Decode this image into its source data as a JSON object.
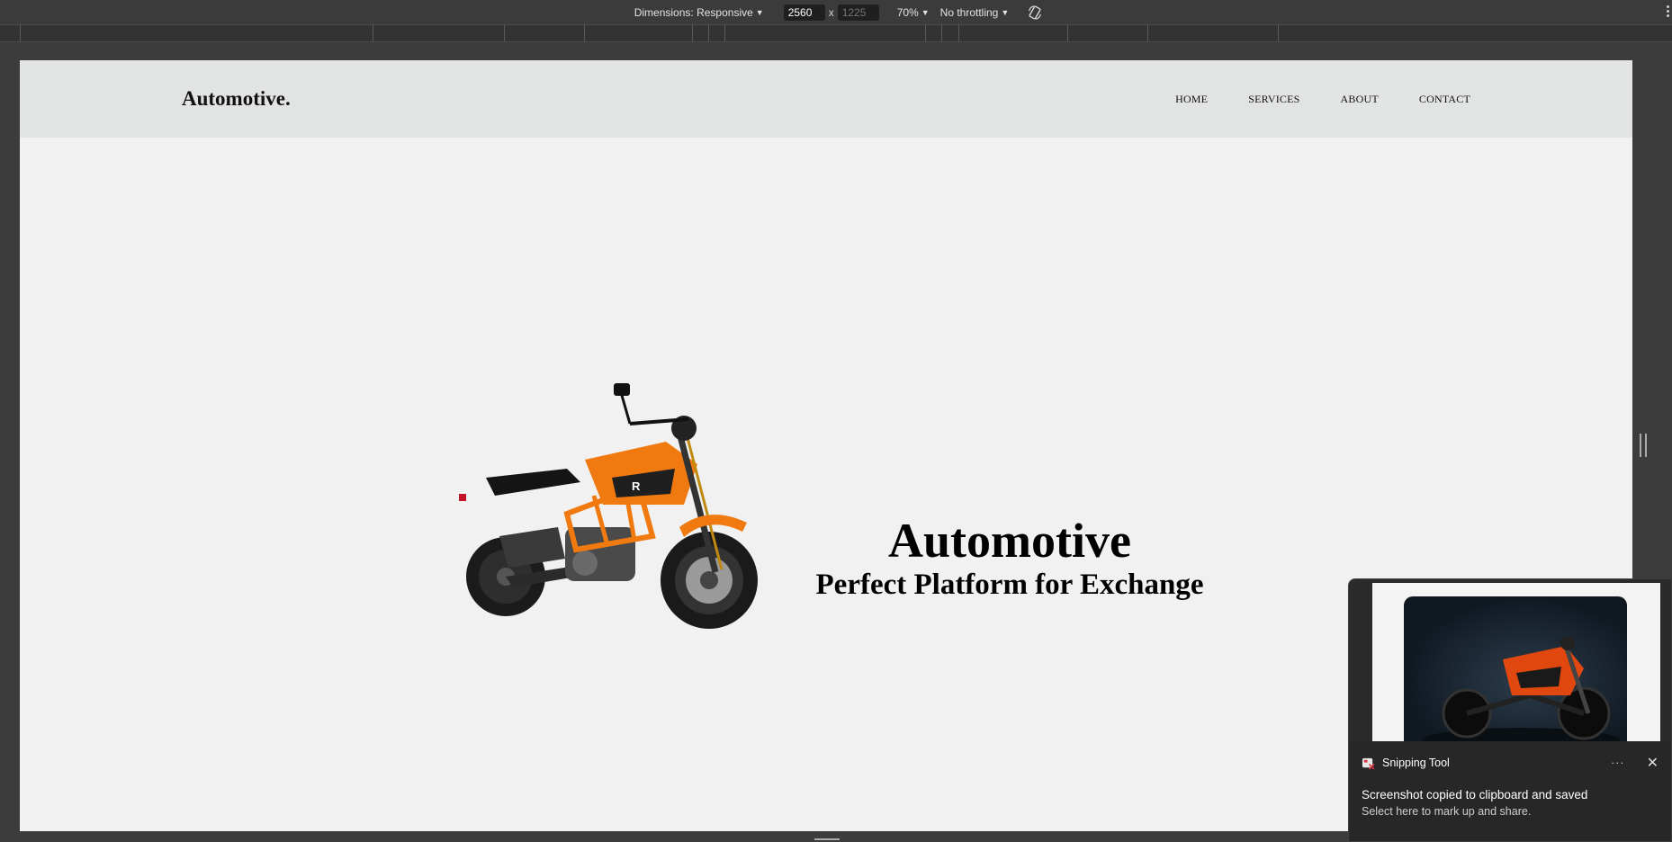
{
  "devtools": {
    "dimensions_label": "Dimensions: Responsive",
    "width_value": "2560",
    "height_placeholder": "1225",
    "times_symbol": "x",
    "zoom": "70%",
    "throttle": "No throttling"
  },
  "site": {
    "brand": "Automotive.",
    "nav": [
      "HOME",
      "SERVICES",
      "ABOUT",
      "CONTACT"
    ],
    "hero_title": "Automotive",
    "hero_subtitle": "Perfect Platform for Exchange"
  },
  "toast": {
    "app_name": "Snipping Tool",
    "more_label": "···",
    "close_label": "✕",
    "message": "Screenshot copied to clipboard and saved",
    "sub_message": "Select here to mark up and share."
  },
  "colors": {
    "devtools_bg": "#3b3b3b",
    "header_bg": "#e2e4e3",
    "page_bg": "#f1f1f1",
    "bike_orange": "#f07a10",
    "toast_bg": "#272727"
  }
}
